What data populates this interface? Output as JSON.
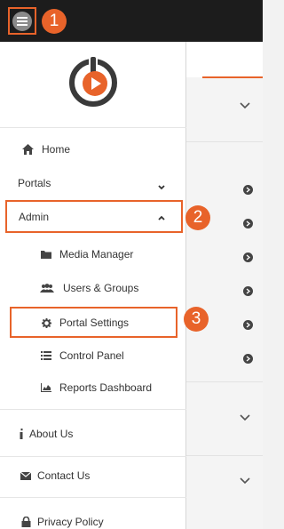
{
  "callouts": {
    "one": "1",
    "two": "2",
    "three": "3"
  },
  "colors": {
    "accent": "#e8632a",
    "topbar": "#1c1c1c",
    "icon": "#444444"
  },
  "menu": {
    "home": {
      "label": "Home",
      "icon": "home-icon"
    },
    "portals": {
      "label": "Portals",
      "icon": "chevron-down-icon"
    },
    "admin": {
      "label": "Admin",
      "icon": "chevron-up-icon"
    },
    "media_manager": {
      "label": "Media Manager",
      "icon": "folder-icon"
    },
    "users_groups": {
      "label": "Users & Groups",
      "icon": "users-icon"
    },
    "portal_settings": {
      "label": "Portal Settings",
      "icon": "gear-icon"
    },
    "control_panel": {
      "label": "Control Panel",
      "icon": "list-icon"
    },
    "reports_dashboard": {
      "label": "Reports Dashboard",
      "icon": "area-chart-icon"
    },
    "about_us": {
      "label": "About Us",
      "icon": "info-icon"
    },
    "contact_us": {
      "label": "Contact Us",
      "icon": "envelope-icon"
    },
    "privacy_policy": {
      "label": "Privacy Policy",
      "icon": "lock-icon"
    }
  }
}
